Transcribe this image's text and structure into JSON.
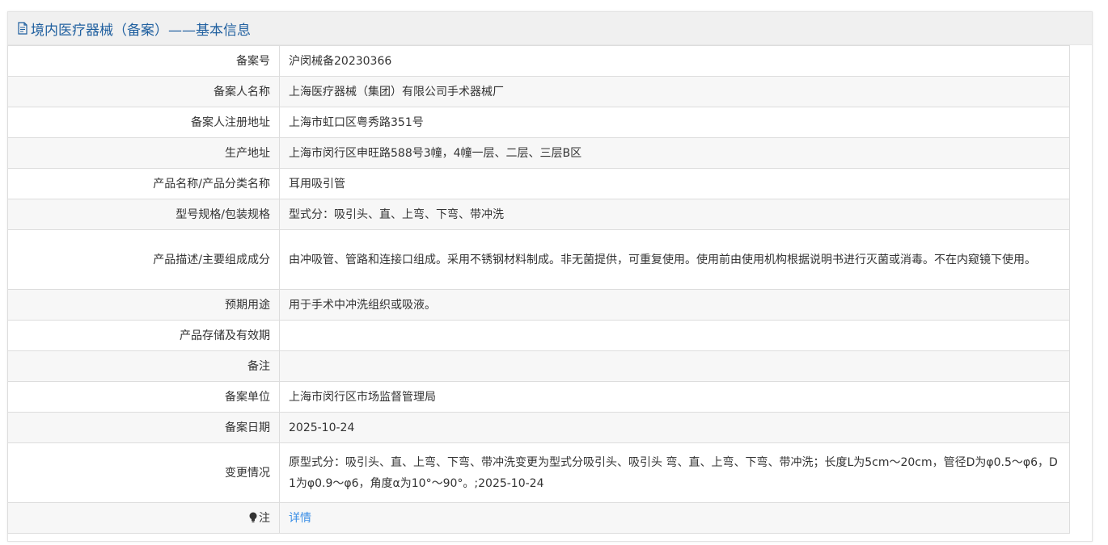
{
  "header": {
    "title": "境内医疗器械（备案）——基本信息",
    "icon": "document-icon"
  },
  "rows": [
    {
      "label": "备案号",
      "value": "沪闵械备20230366"
    },
    {
      "label": "备案人名称",
      "value": "上海医疗器械（集团）有限公司手术器械厂"
    },
    {
      "label": "备案人注册地址",
      "value": "上海市虹口区粤秀路351号"
    },
    {
      "label": "生产地址",
      "value": "上海市闵行区申旺路588号3幢，4幢一层、二层、三层B区"
    },
    {
      "label": "产品名称/产品分类名称",
      "value": "耳用吸引管"
    },
    {
      "label": "型号规格/包装规格",
      "value": "型式分：吸引头、直、上弯、下弯、带冲洗"
    },
    {
      "label": "产品描述/主要组成成分",
      "value": "由冲吸管、管路和连接口组成。采用不锈钢材料制成。非无菌提供，可重复使用。使用前由使用机构根据说明书进行灭菌或消毒。不在内窥镜下使用。"
    },
    {
      "label": "预期用途",
      "value": "用于手术中冲洗组织或吸液。"
    },
    {
      "label": "产品存储及有效期",
      "value": ""
    },
    {
      "label": "备注",
      "value": ""
    },
    {
      "label": "备案单位",
      "value": "上海市闵行区市场监督管理局"
    },
    {
      "label": "备案日期",
      "value": "2025-10-24"
    },
    {
      "label": "变更情况",
      "value": "原型式分：吸引头、直、上弯、下弯、带冲洗变更为型式分吸引头、吸引头 弯、直、上弯、下弯、带冲洗；长度L为5cm～20cm，管径D为φ0.5～φ6，D1为φ0.9～φ6，角度α为10°～90°。;2025-10-24"
    }
  ],
  "note": {
    "label": "注",
    "icon": "lightbulb-icon",
    "link_text": "详情"
  },
  "colors": {
    "header_text": "#1f5f9f",
    "link": "#3a8ee6",
    "border": "#dddddd",
    "stripe": "#f7f7f7"
  }
}
